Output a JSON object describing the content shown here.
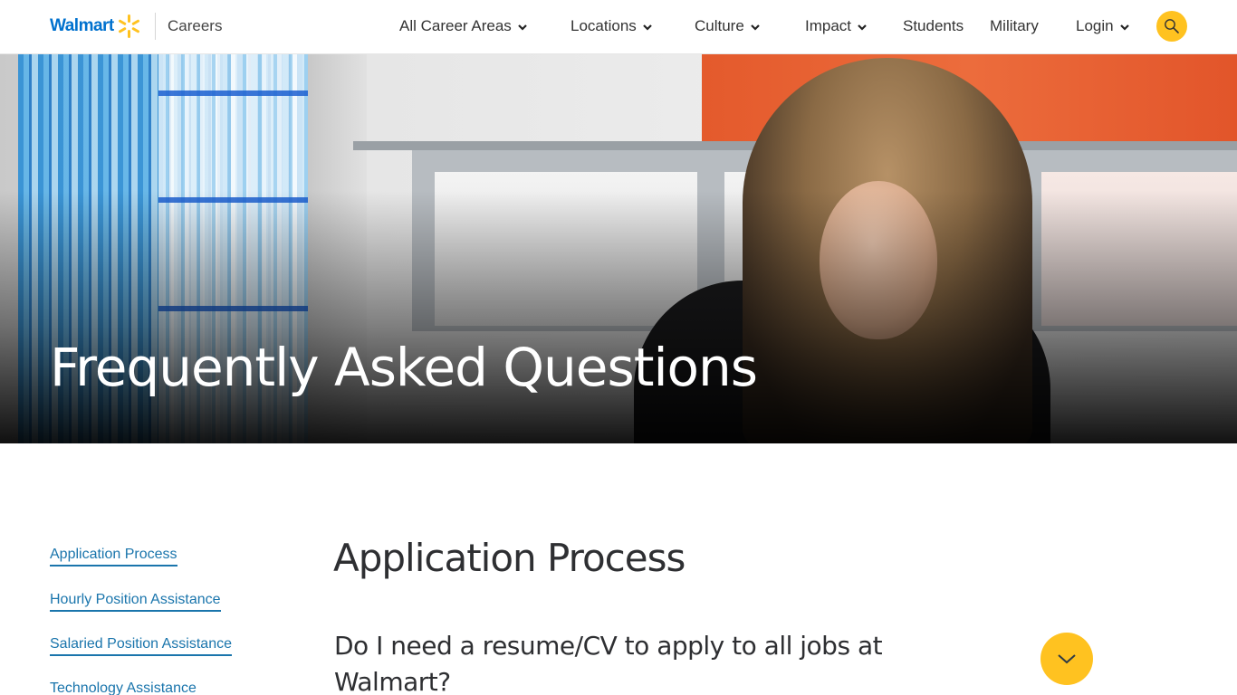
{
  "header": {
    "logo_text": "Walmart",
    "logo_icon": "spark-icon",
    "section_label": "Careers",
    "nav": [
      {
        "label": "All Career Areas",
        "has_dropdown": true
      },
      {
        "label": "Locations",
        "has_dropdown": true
      },
      {
        "label": "Culture",
        "has_dropdown": true
      },
      {
        "label": "Impact",
        "has_dropdown": true
      },
      {
        "label": "Students",
        "has_dropdown": false
      },
      {
        "label": "Military",
        "has_dropdown": false
      },
      {
        "label": "Login",
        "has_dropdown": true
      }
    ],
    "search_icon": "search-icon"
  },
  "hero": {
    "title": "Frequently Asked Questions"
  },
  "sidebar": {
    "links": [
      {
        "label": "Application Process"
      },
      {
        "label": "Hourly Position Assistance"
      },
      {
        "label": "Salaried Position Assistance"
      },
      {
        "label": "Technology Assistance"
      }
    ]
  },
  "main": {
    "section_title": "Application Process",
    "faq": [
      {
        "question": "Do I need a resume/CV to apply to all jobs at Walmart?",
        "expanded": false,
        "toggle_icon": "chevron-down-icon"
      }
    ]
  },
  "colors": {
    "brand_blue": "#0071ce",
    "spark_yellow": "#ffc220",
    "link_blue": "#1a75ac",
    "text_dark": "#2e2f32"
  }
}
